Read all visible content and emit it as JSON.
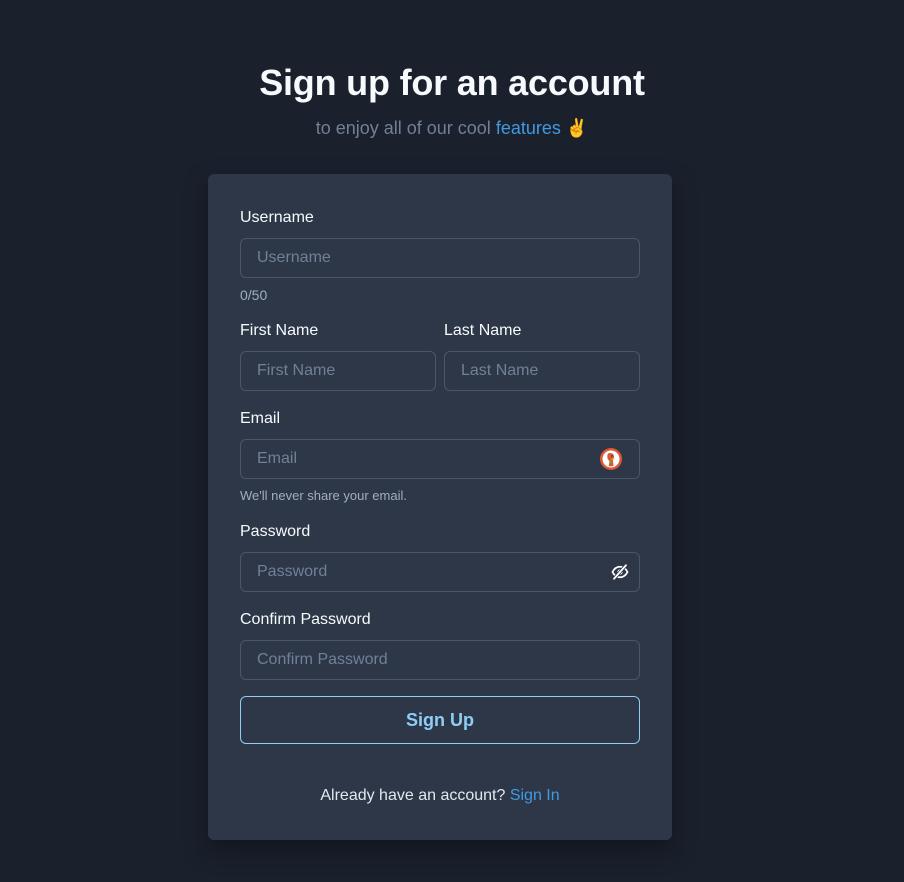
{
  "header": {
    "title": "Sign up for an account",
    "subtitle_prefix": "to enjoy all of our cool ",
    "subtitle_link": "features",
    "subtitle_emoji": "✌️"
  },
  "form": {
    "username": {
      "label": "Username",
      "placeholder": "Username",
      "value": "",
      "counter": "0/50"
    },
    "first_name": {
      "label": "First Name",
      "placeholder": "First Name",
      "value": ""
    },
    "last_name": {
      "label": "Last Name",
      "placeholder": "Last Name",
      "value": ""
    },
    "email": {
      "label": "Email",
      "placeholder": "Email",
      "value": "",
      "helper": "We'll never share your email.",
      "icon": "duckduckgo-icon"
    },
    "password": {
      "label": "Password",
      "placeholder": "Password",
      "value": "",
      "icon": "eye-slash-icon"
    },
    "confirm_password": {
      "label": "Confirm Password",
      "placeholder": "Confirm Password",
      "value": ""
    },
    "submit_label": "Sign Up"
  },
  "footer": {
    "prompt": "Already have an account? ",
    "link": "Sign In"
  },
  "colors": {
    "background": "#1a202c",
    "card": "#2d3748",
    "border": "#4a5568",
    "accent_link": "#4299e1",
    "button_accent": "#90cdf4"
  }
}
